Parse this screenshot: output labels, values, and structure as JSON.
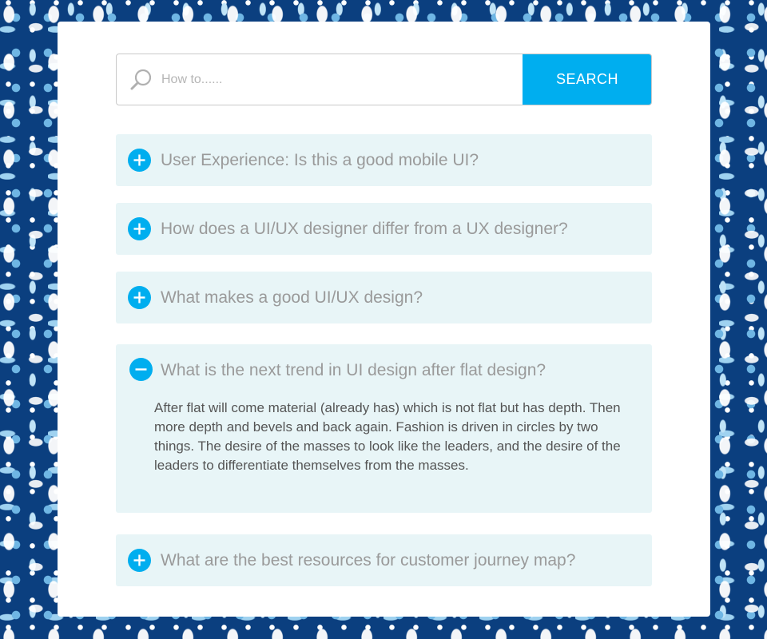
{
  "search": {
    "placeholder": "How to......",
    "button_label": "SEARCH"
  },
  "faq": [
    {
      "question": "User Experience: Is this a good mobile UI?",
      "expanded": false
    },
    {
      "question": "How does a UI/UX designer differ from a UX designer?",
      "expanded": false
    },
    {
      "question": "What makes a good UI/UX design?",
      "expanded": false
    },
    {
      "question": "What is the next trend in UI design after flat design?",
      "expanded": true,
      "answer": "After flat will come material (already has) which is not flat but has depth. Then more depth and bevels and back again. Fashion is driven in circles by two things. The desire of the masses to look like the leaders, and the desire of the leaders to differentiate themselves from the masses."
    },
    {
      "question": "What are the best resources for customer journey map?",
      "expanded": false
    }
  ],
  "colors": {
    "accent": "#00aeef",
    "item_background": "#e8f5f7",
    "pattern_dark": "#0b3f7f",
    "question_text": "#9a9a9a"
  },
  "icons": {
    "search": "search-icon",
    "collapsed": "plus-circle-icon",
    "expanded": "minus-circle-icon",
    "background": "damask-pattern"
  }
}
